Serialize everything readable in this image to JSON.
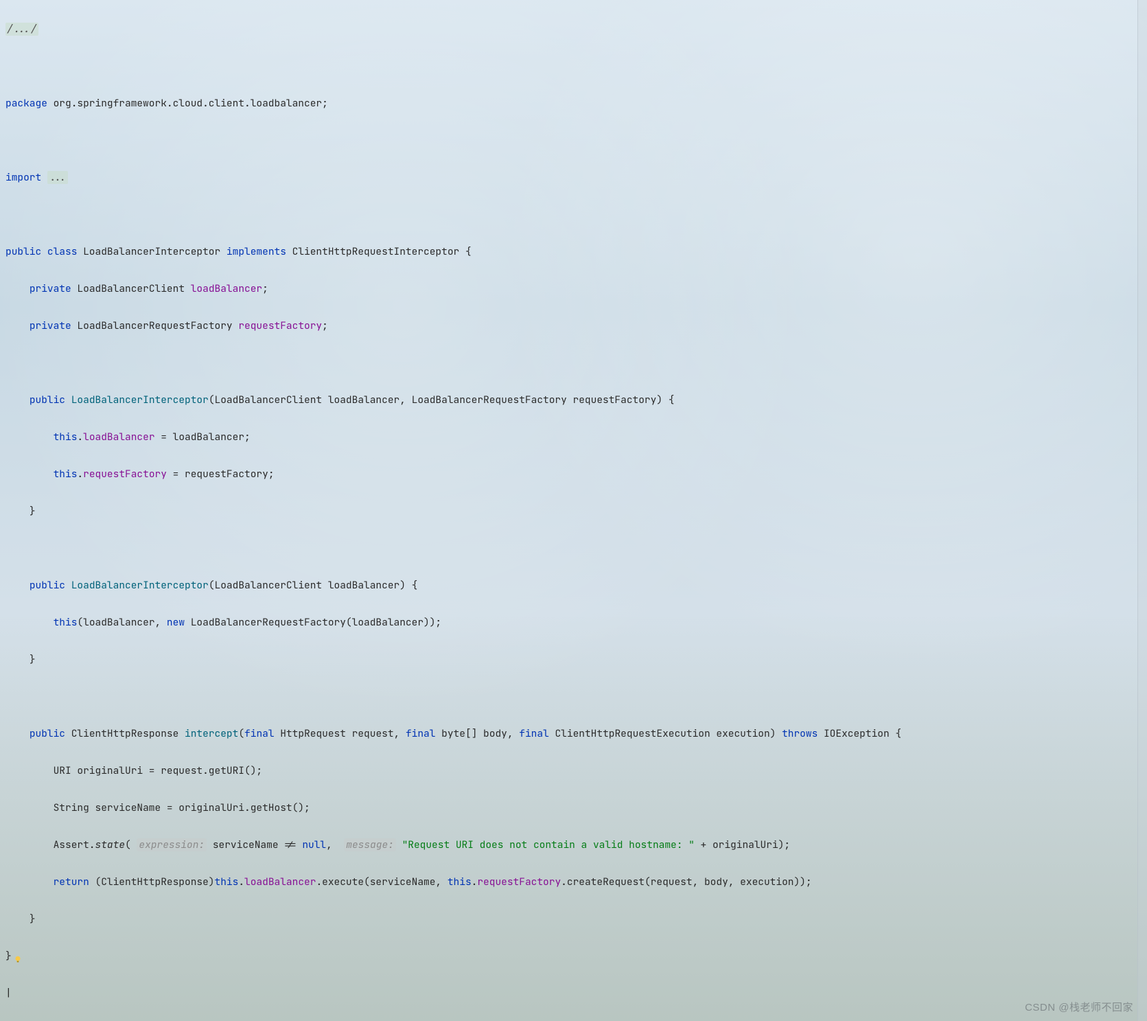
{
  "comment_fold": "/.../",
  "pkg_kw": "package",
  "pkg_name": "org.springframework.cloud.client.loadbalancer;",
  "import_kw": "import",
  "import_fold": "...",
  "class_decl": {
    "public": "public",
    "class": "class",
    "name": "LoadBalancerInterceptor",
    "implements": "implements",
    "iface": "ClientHttpRequestInterceptor",
    "open": " {"
  },
  "fields": {
    "f1_mod": "private",
    "f1_type": "LoadBalancerClient",
    "f1_name": "loadBalancer",
    "f1_end": ";",
    "f2_mod": "private",
    "f2_type": "LoadBalancerRequestFactory",
    "f2_name": "requestFactory",
    "f2_end": ";"
  },
  "ctor1": {
    "public": "public",
    "name": "LoadBalancerInterceptor",
    "params": "(LoadBalancerClient loadBalancer, LoadBalancerRequestFactory requestFactory) {",
    "l1_this": "this",
    "l1_dot": ".",
    "l1_field": "loadBalancer",
    "l1_rest": " = loadBalancer;",
    "l2_this": "this",
    "l2_dot": ".",
    "l2_field": "requestFactory",
    "l2_rest": " = requestFactory;",
    "close": "}"
  },
  "ctor2": {
    "public": "public",
    "name": "LoadBalancerInterceptor",
    "params": "(LoadBalancerClient loadBalancer) {",
    "body_this": "this",
    "body_mid": "(loadBalancer, ",
    "body_new": "new",
    "body_rest": " LoadBalancerRequestFactory(loadBalancer));",
    "close": "}"
  },
  "method": {
    "public": "public",
    "rettype": "ClientHttpResponse",
    "name": "intercept",
    "sig_open": "(",
    "final1": "final",
    "p1": " HttpRequest request, ",
    "final2": "final",
    "p2": " byte[] body, ",
    "final3": "final",
    "p3": " ClientHttpRequestExecution execution) ",
    "throws": "throws",
    "exc": " IOException {",
    "l1": "URI originalUri = request.getURI();",
    "l2": "String serviceName = originalUri.getHost();",
    "l3_pre": "Assert.",
    "l3_state": "state",
    "l3_open": "( ",
    "l3_hint1": "expression:",
    "l3_mid1": " serviceName != ",
    "l3_null": "null",
    "l3_comma": ",  ",
    "l3_hint2": "message:",
    "l3_sp": " ",
    "l3_str": "\"Request URI does not contain a valid hostname: \"",
    "l3_end": " + originalUri);",
    "l4_ret": "return",
    "l4_a": " (ClientHttpResponse)",
    "l4_this": "this",
    "l4_dot": ".",
    "l4_fld1": "loadBalancer",
    "l4_b": ".execute(serviceName, ",
    "l4_this2": "this",
    "l4_dot2": ".",
    "l4_fld2": "requestFactory",
    "l4_c": ".createRequest(request, body, execution));",
    "close": "}"
  },
  "class_close": "}",
  "watermark": "CSDN @栈老师不回家"
}
